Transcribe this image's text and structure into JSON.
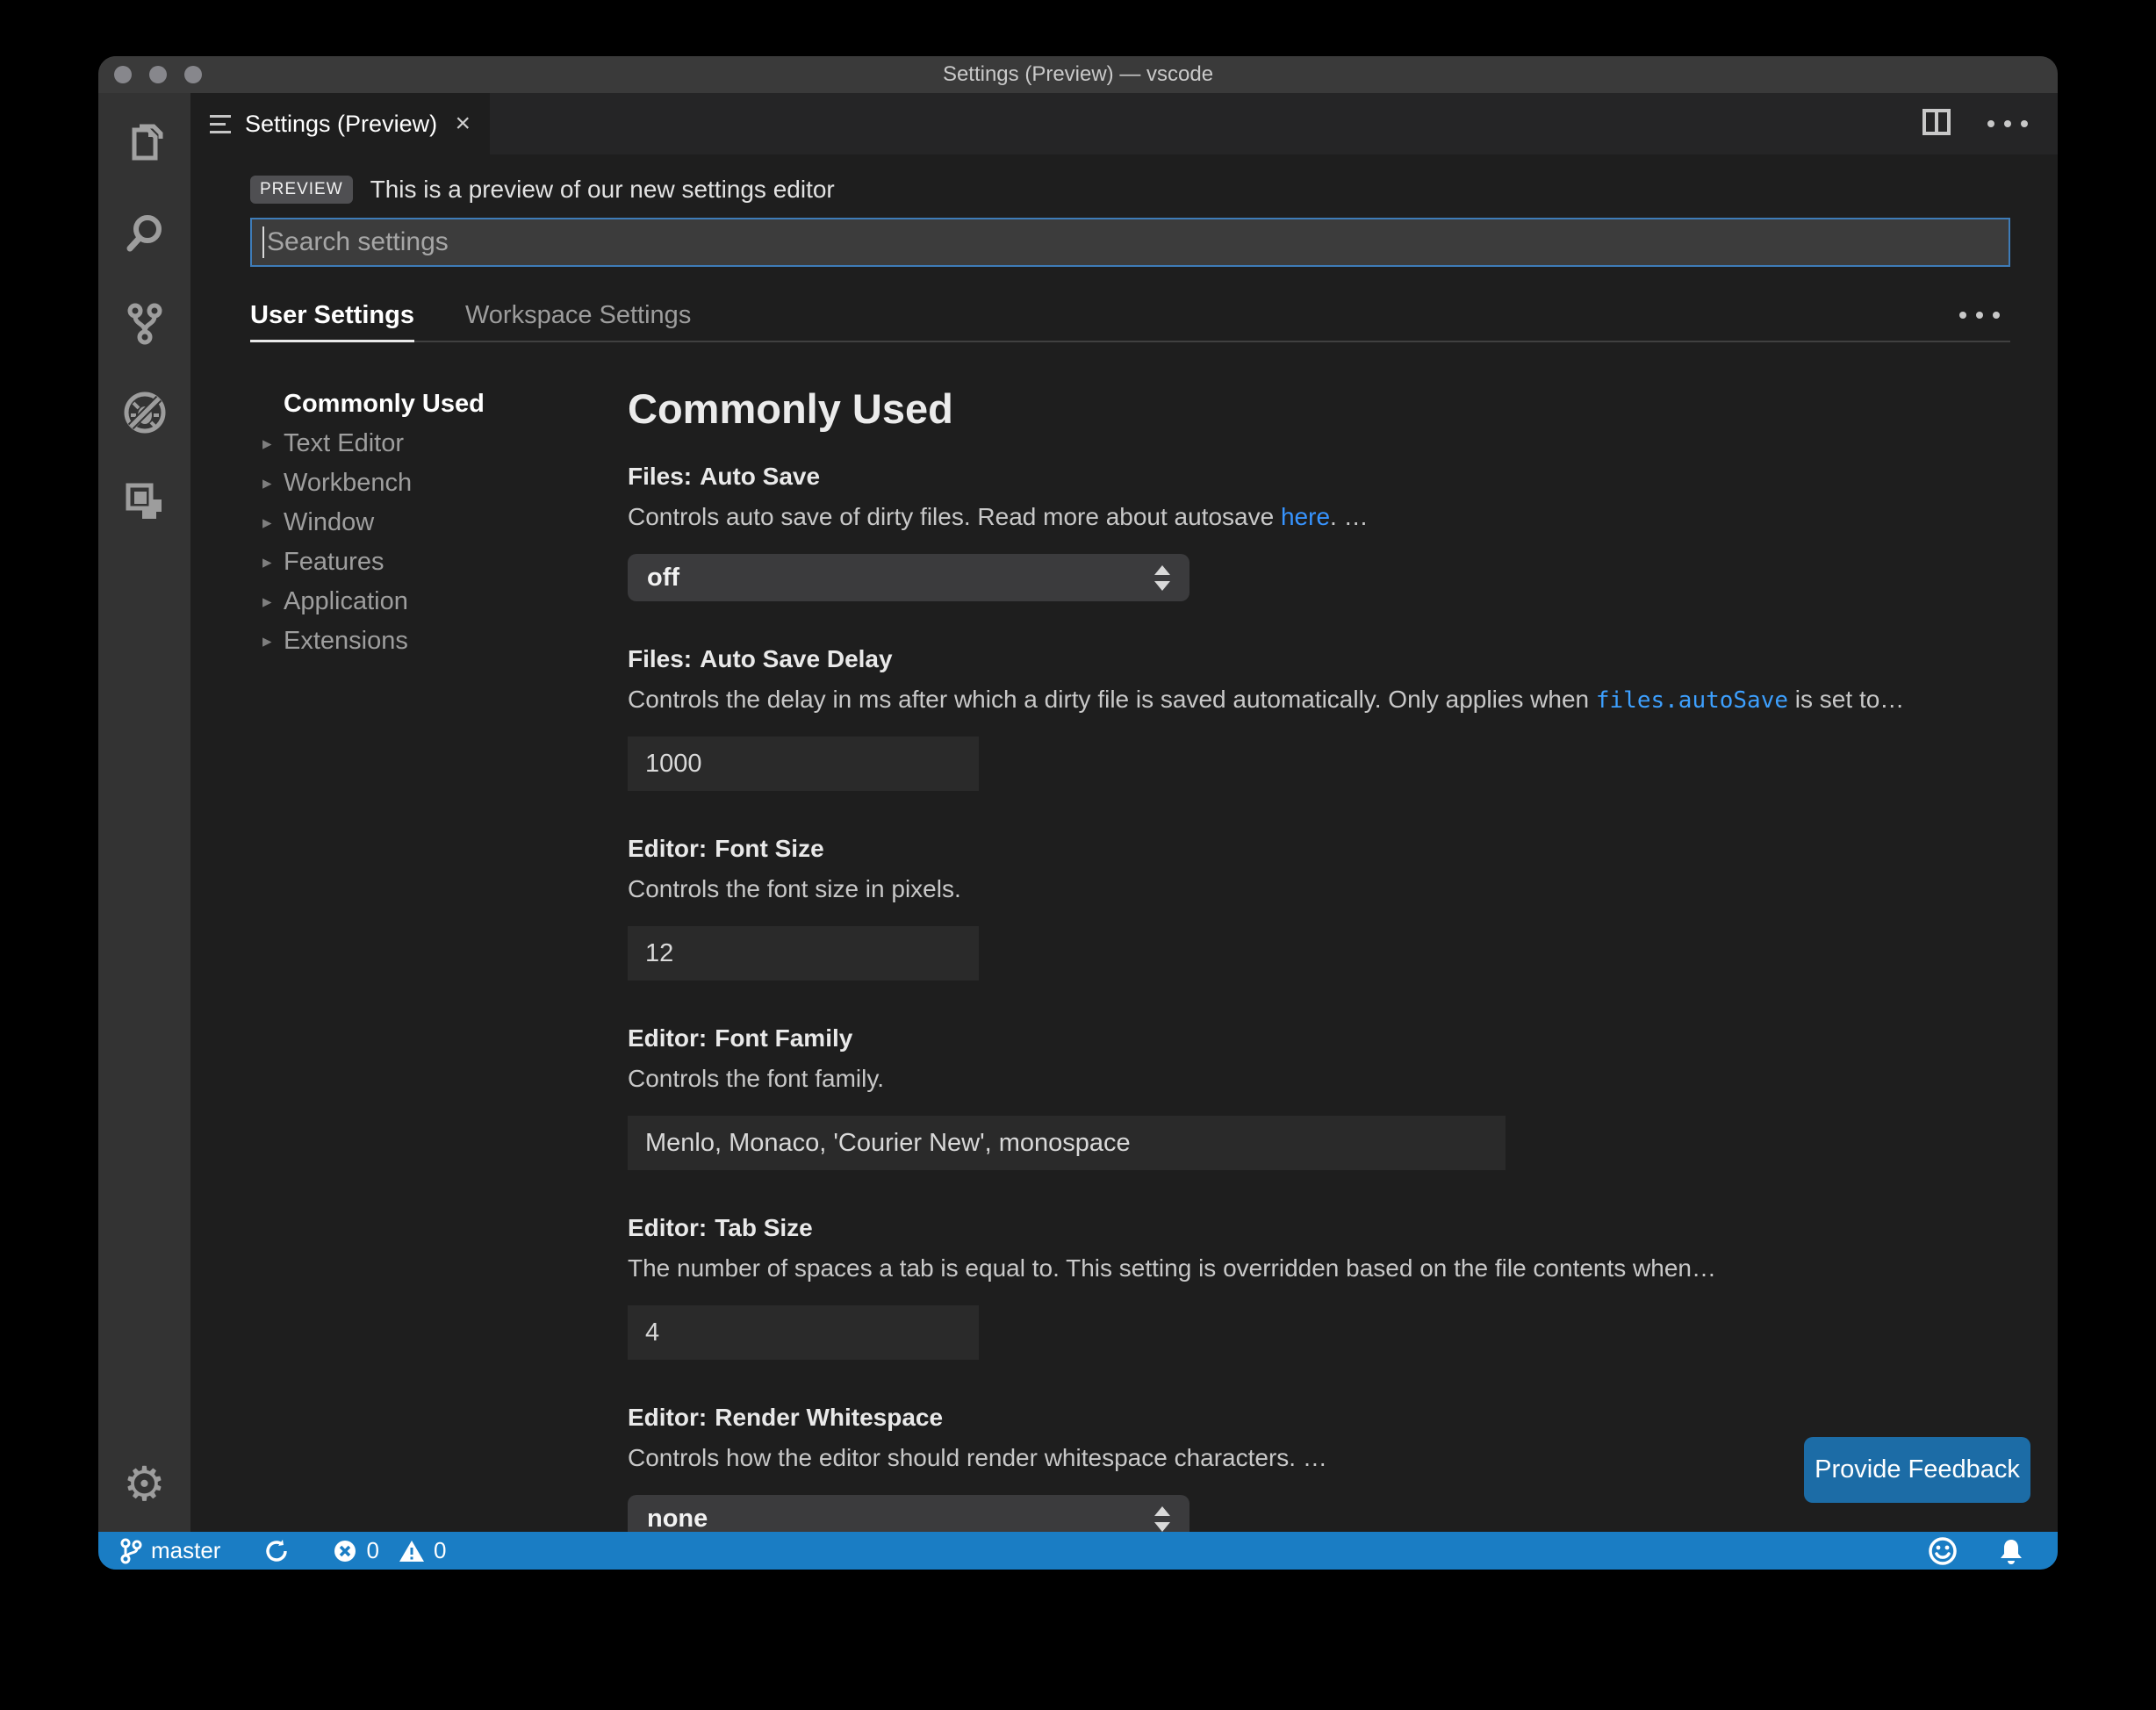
{
  "window": {
    "title": "Settings (Preview) — vscode"
  },
  "tab": {
    "label": "Settings (Preview)",
    "close_glyph": "×"
  },
  "preview_banner": {
    "badge": "PREVIEW",
    "text": "This is a preview of our new settings editor"
  },
  "search": {
    "placeholder": "Search settings"
  },
  "settings_tabs": {
    "user": "User Settings",
    "workspace": "Workspace Settings"
  },
  "toc": {
    "chevron": "▸",
    "items": [
      {
        "label": "Commonly Used",
        "active": true
      },
      {
        "label": "Text Editor"
      },
      {
        "label": "Workbench"
      },
      {
        "label": "Window"
      },
      {
        "label": "Features"
      },
      {
        "label": "Application"
      },
      {
        "label": "Extensions"
      }
    ]
  },
  "content": {
    "heading": "Commonly Used",
    "settings": [
      {
        "prefix": "Files:",
        "name": "Auto Save",
        "desc1": "Controls auto save of dirty files. Read more about autosave ",
        "link": "here",
        "desc2": ". …",
        "control": "select",
        "value": "off"
      },
      {
        "prefix": "Files:",
        "name": "Auto Save Delay",
        "desc1": "Controls the delay in ms after which a dirty file is saved automatically. Only applies when ",
        "code": "files.autoSave",
        "desc2": " is set to…",
        "control": "input",
        "value": "1000"
      },
      {
        "prefix": "Editor:",
        "name": "Font Size",
        "desc1": "Controls the font size in pixels.",
        "control": "input",
        "value": "12"
      },
      {
        "prefix": "Editor:",
        "name": "Font Family",
        "desc1": "Controls the font family.",
        "control": "input",
        "value": "Menlo, Monaco, 'Courier New', monospace"
      },
      {
        "prefix": "Editor:",
        "name": "Tab Size",
        "desc1": "The number of spaces a tab is equal to. This setting is overridden based on the file contents when…",
        "control": "input",
        "value": "4"
      },
      {
        "prefix": "Editor:",
        "name": "Render Whitespace",
        "desc1": "Controls how the editor should render whitespace characters. …",
        "control": "select",
        "value": "none"
      }
    ],
    "feedback_button": "Provide Feedback"
  },
  "status_bar": {
    "branch": "master",
    "errors": "0",
    "warnings": "0"
  },
  "colors": {
    "status_bar_blue": "#1a7dc4",
    "button_blue": "#1c6ca6",
    "link_blue": "#3794ff",
    "focus_border_blue": "#3e7cb8",
    "editor_background": "#1e1e1e",
    "titlebar_gray": "#3a3a3a",
    "activitybar_gray": "#333333"
  }
}
